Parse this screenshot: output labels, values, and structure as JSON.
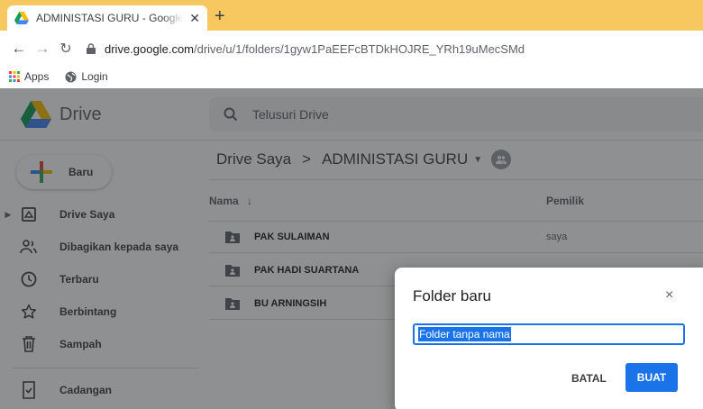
{
  "browser": {
    "tab_title": "ADMINISTASI GURU - Google Drive",
    "new_tab_label": "+",
    "url_host": "drive.google.com",
    "url_path": "/drive/u/1/folders/1gyw1PaEEFcBTDkHOJRE_YRh19uMecSMd",
    "bookmarks": [
      {
        "label": "Apps",
        "icon": "apps-grid-icon"
      },
      {
        "label": "Login",
        "icon": "globe-icon"
      }
    ]
  },
  "drive": {
    "logo_text": "Drive",
    "search_placeholder": "Telusuri Drive",
    "new_button": "Baru",
    "sidebar": [
      {
        "label": "Drive Saya",
        "icon": "my-drive-icon"
      },
      {
        "label": "Dibagikan kepada saya",
        "icon": "shared-people-icon"
      },
      {
        "label": "Terbaru",
        "icon": "clock-icon"
      },
      {
        "label": "Berbintang",
        "icon": "star-icon"
      },
      {
        "label": "Sampah",
        "icon": "trash-icon"
      }
    ],
    "backup": {
      "label": "Cadangan",
      "icon": "backup-icon"
    },
    "breadcrumb": {
      "root": "Drive Saya",
      "separator": ">",
      "current": "ADMINISTASI GURU"
    },
    "columns": {
      "name": "Nama",
      "owner": "Pemilik"
    },
    "files": [
      {
        "name": "PAK SULAIMAN",
        "owner": "saya"
      },
      {
        "name": "PAK HADI SUARTANA",
        "owner": ""
      },
      {
        "name": "BU ARNINGSIH",
        "owner": ""
      }
    ]
  },
  "dialog": {
    "title": "Folder baru",
    "close": "×",
    "input_value": "Folder tanpa nama",
    "cancel": "BATAL",
    "confirm": "BUAT"
  },
  "colors": {
    "accent": "#1a73e8",
    "tabbar": "#f6c85f"
  }
}
